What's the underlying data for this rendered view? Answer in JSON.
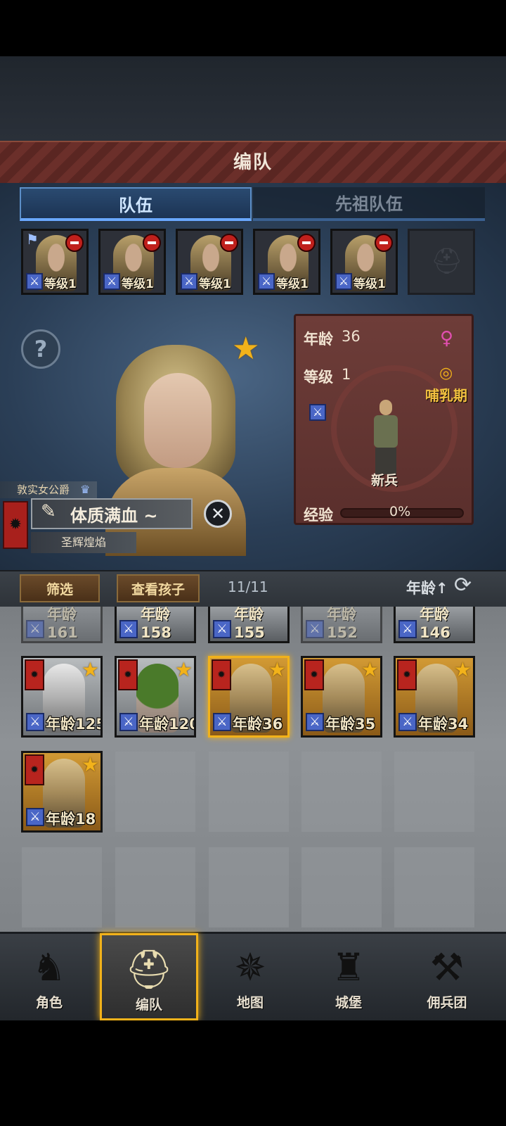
{
  "title": "编队",
  "tabs": [
    {
      "label": "队伍",
      "active": true
    },
    {
      "label": "先祖队伍",
      "active": false
    }
  ],
  "team_slots": [
    {
      "level": "等级1",
      "flag": true
    },
    {
      "level": "等级1"
    },
    {
      "level": "等级1"
    },
    {
      "level": "等级1"
    },
    {
      "level": "等级1"
    }
  ],
  "character": {
    "title": "敦实女公爵",
    "name": "体质满血 ~",
    "house": "圣辉煌焰",
    "stats": {
      "age_label": "年龄",
      "age_value": "36",
      "level_label": "等级",
      "level_value": "1",
      "state": "哺乳期",
      "class": "新兵",
      "exp_label": "经验",
      "exp_value": "0%",
      "exp_fraction": 0.0
    }
  },
  "toolbar": {
    "filter": "筛选",
    "view_children": "查看孩子",
    "count": "11/11",
    "sort": "年龄↑"
  },
  "roster_partial_row": [
    "年龄161",
    "年龄158",
    "年龄155",
    "年龄152",
    "年龄146"
  ],
  "roster": [
    {
      "age": "年龄125",
      "bg": "grey",
      "selected": false
    },
    {
      "age": "年龄120",
      "bg": "grey",
      "selected": false
    },
    {
      "age": "年龄36",
      "bg": "gold",
      "selected": true
    },
    {
      "age": "年龄35",
      "bg": "gold",
      "selected": false
    },
    {
      "age": "年龄34",
      "bg": "gold",
      "selected": false
    },
    {
      "age": "年龄18",
      "bg": "gold",
      "selected": false
    }
  ],
  "nav": [
    {
      "label": "角色",
      "icon": "knight-icon"
    },
    {
      "label": "编队",
      "icon": "helmet-icon",
      "active": true
    },
    {
      "label": "地图",
      "icon": "compass-icon"
    },
    {
      "label": "城堡",
      "icon": "castle-icon"
    },
    {
      "label": "佣兵团",
      "icon": "mercenary-icon"
    }
  ],
  "colors": {
    "accent": "#f2b21a",
    "banner_red": "#b8241e",
    "tab_blue": "#6aa8ff"
  }
}
